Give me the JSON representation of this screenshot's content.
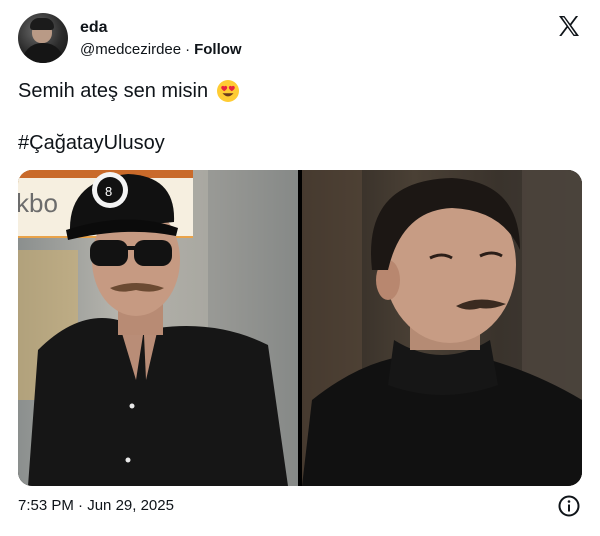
{
  "author": {
    "name": "eda",
    "handle": "@medcezirdee",
    "separator": "·",
    "follow_label": "Follow",
    "avatar_icon": "user-avatar-photo"
  },
  "brand_icon": "x-logo-icon",
  "tweet": {
    "text": "Semih ateş sen misin",
    "emoji": "heart-eyes-emoji",
    "hashtag": "#ÇağatayUlusoy"
  },
  "media": {
    "photos": [
      {
        "description_icon": "photo-man-cap-sunglasses",
        "sign_text": "kbo"
      },
      {
        "description_icon": "photo-man-turtleneck"
      }
    ]
  },
  "footer": {
    "time": "7:53 PM",
    "separator": "·",
    "date": "Jun 29, 2025",
    "info_icon": "info-icon"
  },
  "colors": {
    "text": "#0f1419",
    "background": "#ffffff"
  }
}
